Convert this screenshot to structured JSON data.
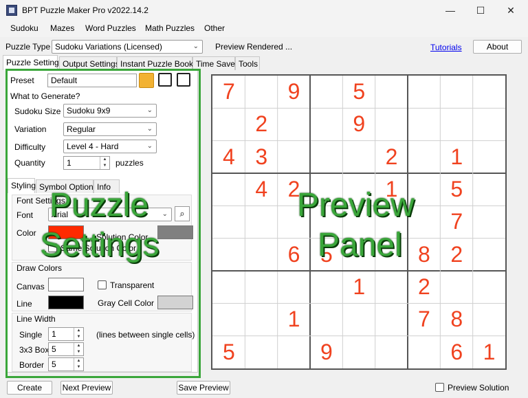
{
  "window": {
    "title": "BPT Puzzle Maker Pro v2022.14.2",
    "minimize": "—",
    "maximize": "☐",
    "close": "✕"
  },
  "menu": [
    "Sudoku",
    "Mazes",
    "Word Puzzles",
    "Math Puzzles",
    "Other"
  ],
  "toolbar": {
    "puzzle_type_label": "Puzzle Type",
    "puzzle_type_value": "Sudoku Variations (Licensed)",
    "status": "Preview Rendered ...",
    "tutorials": "Tutorials",
    "about": "About"
  },
  "tabs": [
    "Puzzle Settings",
    "Output Settings",
    "Instant Puzzle Books",
    "Time Saver",
    "Tools"
  ],
  "settings": {
    "preset_label": "Preset",
    "preset_value": "Default",
    "what_to_generate": "What to Generate?",
    "size_label": "Sudoku Size",
    "size_value": "Sudoku  9x9",
    "variation_label": "Variation",
    "variation_value": "Regular",
    "difficulty_label": "Difficulty",
    "difficulty_value": "Level 4 - Hard",
    "quantity_label": "Quantity",
    "quantity_value": "1",
    "puzzles_label": "puzzles",
    "subtabs": [
      "Styling",
      "Symbol Options",
      "Info"
    ],
    "font_settings": "Font Settings",
    "font_label": "Font",
    "font_value": "Arial",
    "color_label": "Color",
    "solution_color_label": "Solution Color",
    "same_solution_color": "Same Solution Color",
    "draw_colors": "Draw Colors",
    "canvas_label": "Canvas",
    "transparent_label": "Transparent",
    "line_label": "Line",
    "gray_cell_label": "Gray Cell Color",
    "line_width": "Line Width",
    "single_label": "Single",
    "single_value": "1",
    "single_note": "(lines between single cells)",
    "box_label": "3x3 Box",
    "box_value": "5",
    "border_label": "Border",
    "border_value": "5",
    "colors": {
      "font": "#ff2a00",
      "solution": "#808080",
      "canvas": "#ffffff",
      "line": "#000000",
      "gray_cell": "#d3d3d3"
    }
  },
  "overlay": {
    "left_line1": "Puzzle",
    "left_line2": "Settings",
    "right_line1": "Preview",
    "right_line2": "Panel",
    "color": "#3aa63a"
  },
  "grid": [
    [
      "7",
      "",
      "9",
      "",
      "5",
      "",
      "",
      "",
      ""
    ],
    [
      "",
      "2",
      "",
      "",
      "9",
      "",
      "",
      "",
      ""
    ],
    [
      "4",
      "3",
      "",
      "",
      "",
      "2",
      "",
      "1",
      ""
    ],
    [
      "",
      "4",
      "2",
      "",
      "",
      "1",
      "",
      "5",
      ""
    ],
    [
      "",
      "",
      "",
      "",
      "",
      "",
      "",
      "7",
      ""
    ],
    [
      "",
      "",
      "6",
      "5",
      "",
      "",
      "8",
      "2",
      ""
    ],
    [
      "",
      "",
      "",
      "",
      "1",
      "",
      "2",
      "",
      ""
    ],
    [
      "",
      "",
      "1",
      "",
      "",
      "",
      "7",
      "8",
      ""
    ],
    [
      "5",
      "",
      "",
      "9",
      "",
      "",
      "",
      "6",
      "1"
    ]
  ],
  "bottom": {
    "create": "Create",
    "next_preview": "Next Preview",
    "save_preview": "Save Preview",
    "preview_solution": "Preview Solution"
  }
}
